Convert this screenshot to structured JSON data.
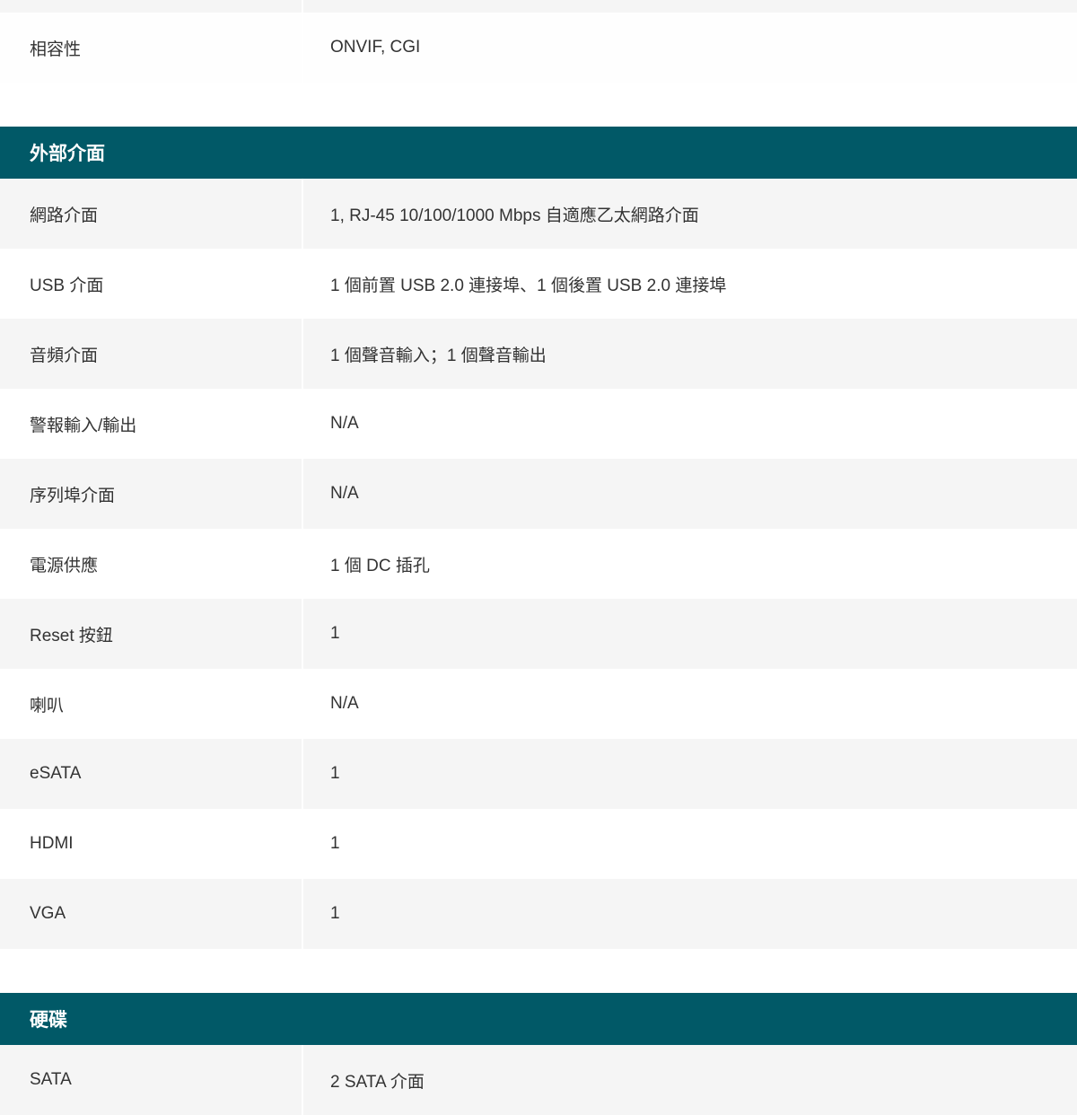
{
  "general": {
    "rows": [
      {
        "label": "相容性",
        "value": "ONVIF, CGI"
      }
    ]
  },
  "external": {
    "title": "外部介面",
    "rows": [
      {
        "label": "網路介面",
        "value": "1, RJ-45 10/100/1000 Mbps 自適應乙太網路介面"
      },
      {
        "label": "USB 介面",
        "value": "1 個前置 USB 2.0 連接埠、1 個後置 USB 2.0 連接埠"
      },
      {
        "label": "音頻介面",
        "value": "1 個聲音輸入；1 個聲音輸出"
      },
      {
        "label": "警報輸入/輸出",
        "value": "N/A"
      },
      {
        "label": "序列埠介面",
        "value": "N/A"
      },
      {
        "label": "電源供應",
        "value": "1 個 DC 插孔"
      },
      {
        "label": "Reset 按鈕",
        "value": "1"
      },
      {
        "label": "喇叭",
        "value": "N/A"
      },
      {
        "label": "eSATA",
        "value": "1"
      },
      {
        "label": "HDMI",
        "value": "1"
      },
      {
        "label": "VGA",
        "value": "1"
      }
    ]
  },
  "harddisk": {
    "title": "硬碟",
    "rows": [
      {
        "label": "SATA",
        "value": "2 SATA 介面"
      }
    ]
  },
  "colors": {
    "header_bg": "#015967",
    "row_gray": "#f5f5f5",
    "row_white": "#ffffff"
  }
}
